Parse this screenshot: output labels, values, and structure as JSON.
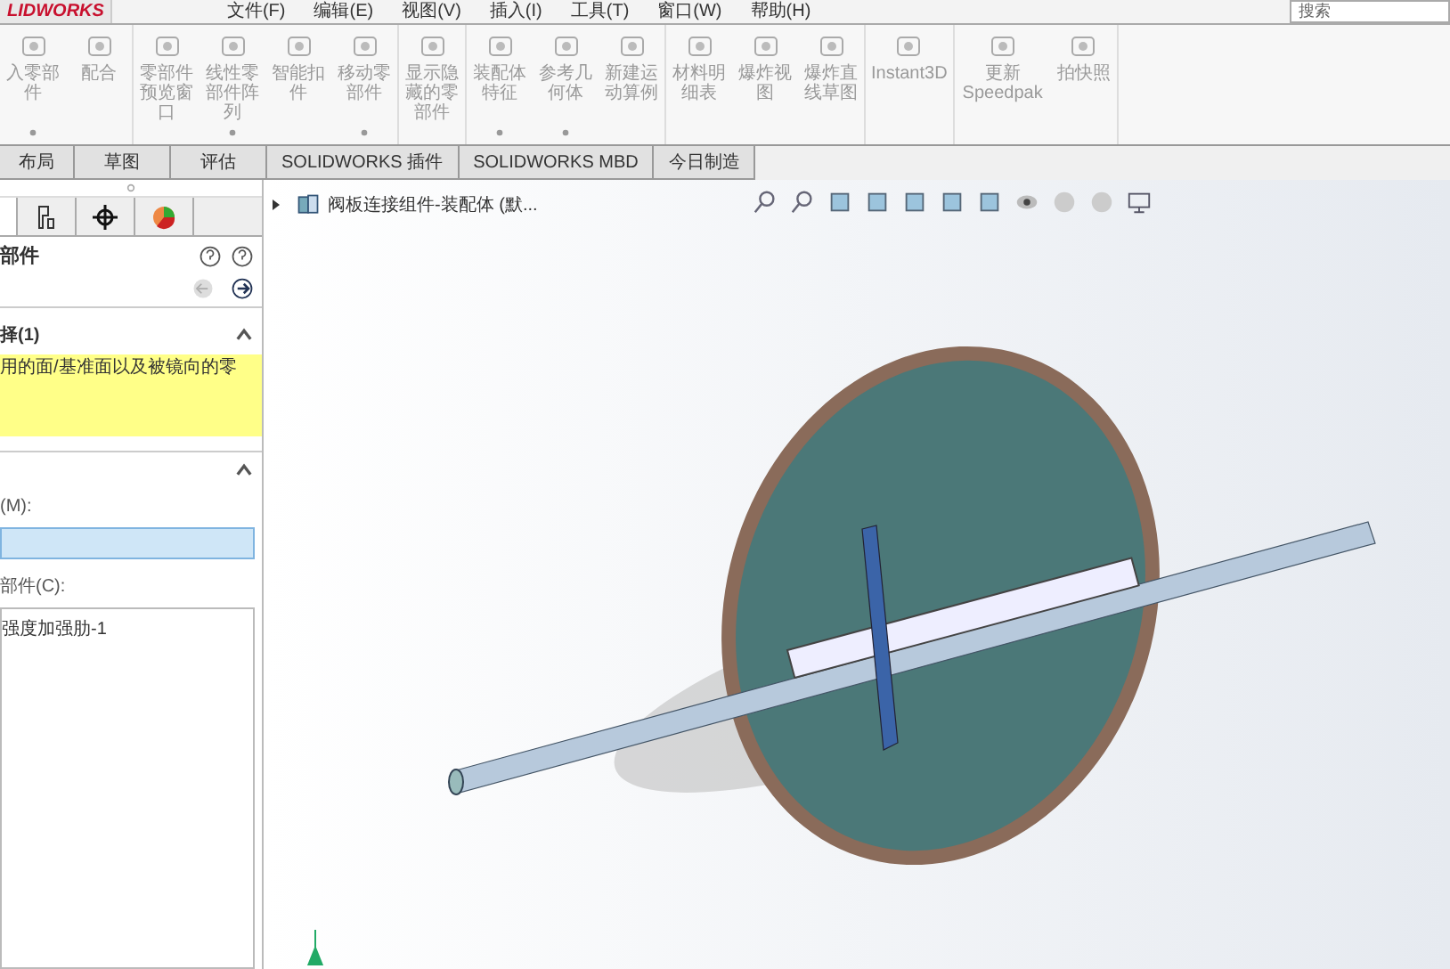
{
  "menu_bar": {
    "logo": "LIDWORKS",
    "menus": [
      "文件(F)",
      "编辑(E)",
      "视图(V)",
      "插入(I)",
      "工具(T)",
      "窗口(W)",
      "帮助(H)"
    ],
    "search": "搜索"
  },
  "ribbon": [
    {
      "label": "入零部件",
      "has_menu": true
    },
    {
      "label": "配合",
      "has_menu": false
    },
    {
      "label": "零部件预览窗口",
      "has_menu": false
    },
    {
      "label": "线性零部件阵列",
      "has_menu": true
    },
    {
      "label": "智能扣件",
      "has_menu": false
    },
    {
      "label": "移动零部件",
      "has_menu": true
    },
    {
      "label": "显示隐藏的零部件",
      "has_menu": false
    },
    {
      "label": "装配体特征",
      "has_menu": true
    },
    {
      "label": "参考几何体",
      "has_menu": true
    },
    {
      "label": "新建运动算例",
      "has_menu": false
    },
    {
      "label": "材料明细表",
      "has_menu": false
    },
    {
      "label": "爆炸视图",
      "has_menu": false
    },
    {
      "label": "爆炸直线草图",
      "has_menu": false
    },
    {
      "label": "Instant3D",
      "has_menu": false
    },
    {
      "label": "更新Speedpak",
      "has_menu": false
    },
    {
      "label": "拍快照",
      "has_menu": false
    }
  ],
  "tabs": [
    {
      "label": "布局",
      "selected": false
    },
    {
      "label": "草图",
      "selected": false
    },
    {
      "label": "评估",
      "selected": false
    },
    {
      "label": "SOLIDWORKS 插件",
      "selected": false
    },
    {
      "label": "SOLIDWORKS MBD",
      "selected": false
    },
    {
      "label": "今日制造",
      "selected": false
    }
  ],
  "panel_tabs": [
    {
      "selected": true
    },
    {
      "selected": false
    },
    {
      "selected": false
    },
    {
      "selected": false
    }
  ],
  "property_manager": {
    "title": "部件",
    "selection_section": {
      "title": "择(1)",
      "expanded": true,
      "message": "用的面/基准面以及被镜向的零"
    },
    "components_section": {
      "expanded": true,
      "field_label": "(M):",
      "list_label": "部件(C):",
      "list_items": [
        "强度加强肋-1"
      ]
    }
  },
  "feature_tree": {
    "root": "阀板连接组件-装配体 (默...",
    "expanded": false
  }
}
